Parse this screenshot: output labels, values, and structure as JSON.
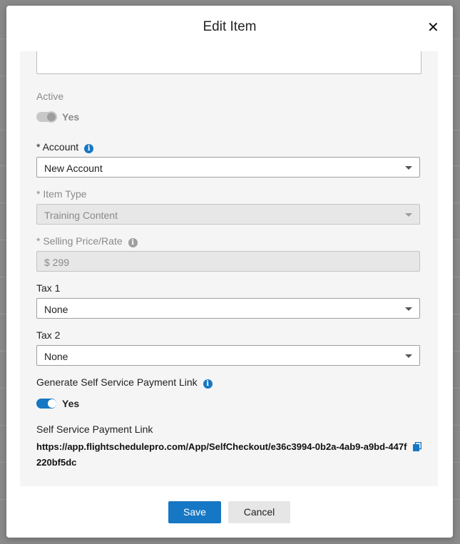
{
  "modal": {
    "title": "Edit Item",
    "close_glyph": "✕"
  },
  "form": {
    "active": {
      "label": "Active",
      "value": "Yes",
      "enabled": true,
      "disabled": true
    },
    "account": {
      "label": "* Account",
      "value": "New Account",
      "info_icon": "info-icon"
    },
    "item_type": {
      "label": "* Item Type",
      "value": "Training Content"
    },
    "selling_price": {
      "label": "* Selling Price/Rate",
      "value": "$ 299",
      "info_icon": "info-icon"
    },
    "tax1": {
      "label": "Tax 1",
      "value": "None"
    },
    "tax2": {
      "label": "Tax 2",
      "value": "None"
    },
    "generate_link": {
      "label": "Generate Self Service Payment Link",
      "value": "Yes",
      "enabled": true,
      "info_icon": "info-icon"
    },
    "payment_link": {
      "label": "Self Service Payment Link",
      "value": "https://app.flightschedulepro.com/App/SelfCheckout/e36c3994-0b2a-4ab9-a9bd-447f220bf5dc",
      "copy_icon": "copy-icon"
    }
  },
  "footer": {
    "save_label": "Save",
    "cancel_label": "Cancel"
  },
  "colors": {
    "accent": "#1677c4",
    "backdrop": "#8a8a8a",
    "panel": "#f5f5f5"
  }
}
